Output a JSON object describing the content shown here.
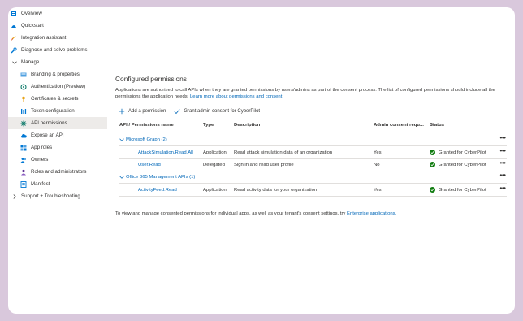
{
  "sidebar": {
    "items": [
      {
        "label": "Overview",
        "icon": "overview-icon"
      },
      {
        "label": "Quickstart",
        "icon": "quickstart-icon"
      },
      {
        "label": "Integration assistant",
        "icon": "rocket-icon"
      },
      {
        "label": "Diagnose and solve problems",
        "icon": "wrench-icon"
      },
      {
        "label": "Manage",
        "icon": "chevron-down-icon"
      },
      {
        "label": "Branding & properties",
        "icon": "branding-icon"
      },
      {
        "label": "Authentication (Preview)",
        "icon": "authentication-icon"
      },
      {
        "label": "Certificates & secrets",
        "icon": "key-icon"
      },
      {
        "label": "Token configuration",
        "icon": "token-icon"
      },
      {
        "label": "API permissions",
        "icon": "api-permissions-icon"
      },
      {
        "label": "Expose an API",
        "icon": "cloud-icon"
      },
      {
        "label": "App roles",
        "icon": "app-roles-icon"
      },
      {
        "label": "Owners",
        "icon": "owners-icon"
      },
      {
        "label": "Roles and administrators",
        "icon": "roles-icon"
      },
      {
        "label": "Manifest",
        "icon": "manifest-icon"
      },
      {
        "label": "Support + Troubleshooting",
        "icon": "chevron-right-icon"
      }
    ]
  },
  "main": {
    "title": "Configured permissions",
    "description": "Applications are authorized to call APIs when they are granted permissions by users/admins as part of the consent process. The list of configured permissions should include all the permissions the application needs.",
    "description_link": "Learn more about permissions and consent",
    "toolbar": {
      "add_label": "Add a permission",
      "grant_label": "Grant admin consent for CyberPilot"
    },
    "table": {
      "headers": {
        "api": "API / Permissions name",
        "type": "Type",
        "description": "Description",
        "admin": "Admin consent requ...",
        "status": "Status"
      },
      "groups": [
        {
          "name": "Microsoft Graph (2)",
          "rows": [
            {
              "name": "AttackSimulation.Read.All",
              "type": "Application",
              "description": "Read attack simulation data of an organization",
              "admin": "Yes",
              "status": "Granted for CyberPilot"
            },
            {
              "name": "User.Read",
              "type": "Delegated",
              "description": "Sign in and read user profile",
              "admin": "No",
              "status": "Granted for CyberPilot"
            }
          ]
        },
        {
          "name": "Office 365 Management APIs (1)",
          "rows": [
            {
              "name": "ActivityFeed.Read",
              "type": "Application",
              "description": "Read activity data for your organization",
              "admin": "Yes",
              "status": "Granted for CyberPilot"
            }
          ]
        }
      ]
    },
    "footer_text": "To view and manage consented permissions for individual apps, as well as your tenant's consent settings, try",
    "footer_link": "Enterprise applications."
  },
  "colors": {
    "accent": "#0067b8",
    "success": "#107c10",
    "active_bg": "#edebe9",
    "frame_bg": "#d9c8dc"
  }
}
